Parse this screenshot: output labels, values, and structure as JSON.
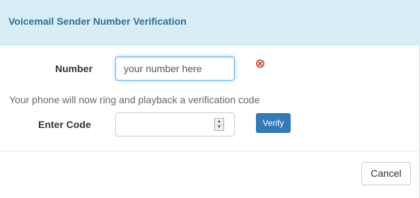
{
  "modal": {
    "title": "Voicemail Sender Number Verification"
  },
  "form": {
    "number_label": "Number",
    "number_placeholder": "your number here",
    "number_value": "",
    "info_text": "Your phone will now ring and playback a verification code",
    "code_label": "Enter Code",
    "code_value": "",
    "verify_label": "Verify"
  },
  "footer": {
    "cancel_label": "Cancel"
  },
  "icons": {
    "clear": "clear-circle-icon",
    "spin_up": "spin-up-icon",
    "spin_down": "spin-down-icon"
  },
  "colors": {
    "header_bg": "#d9edf7",
    "header_text": "#31708f",
    "primary": "#337ab7",
    "clear_icon": "#c9302c"
  }
}
